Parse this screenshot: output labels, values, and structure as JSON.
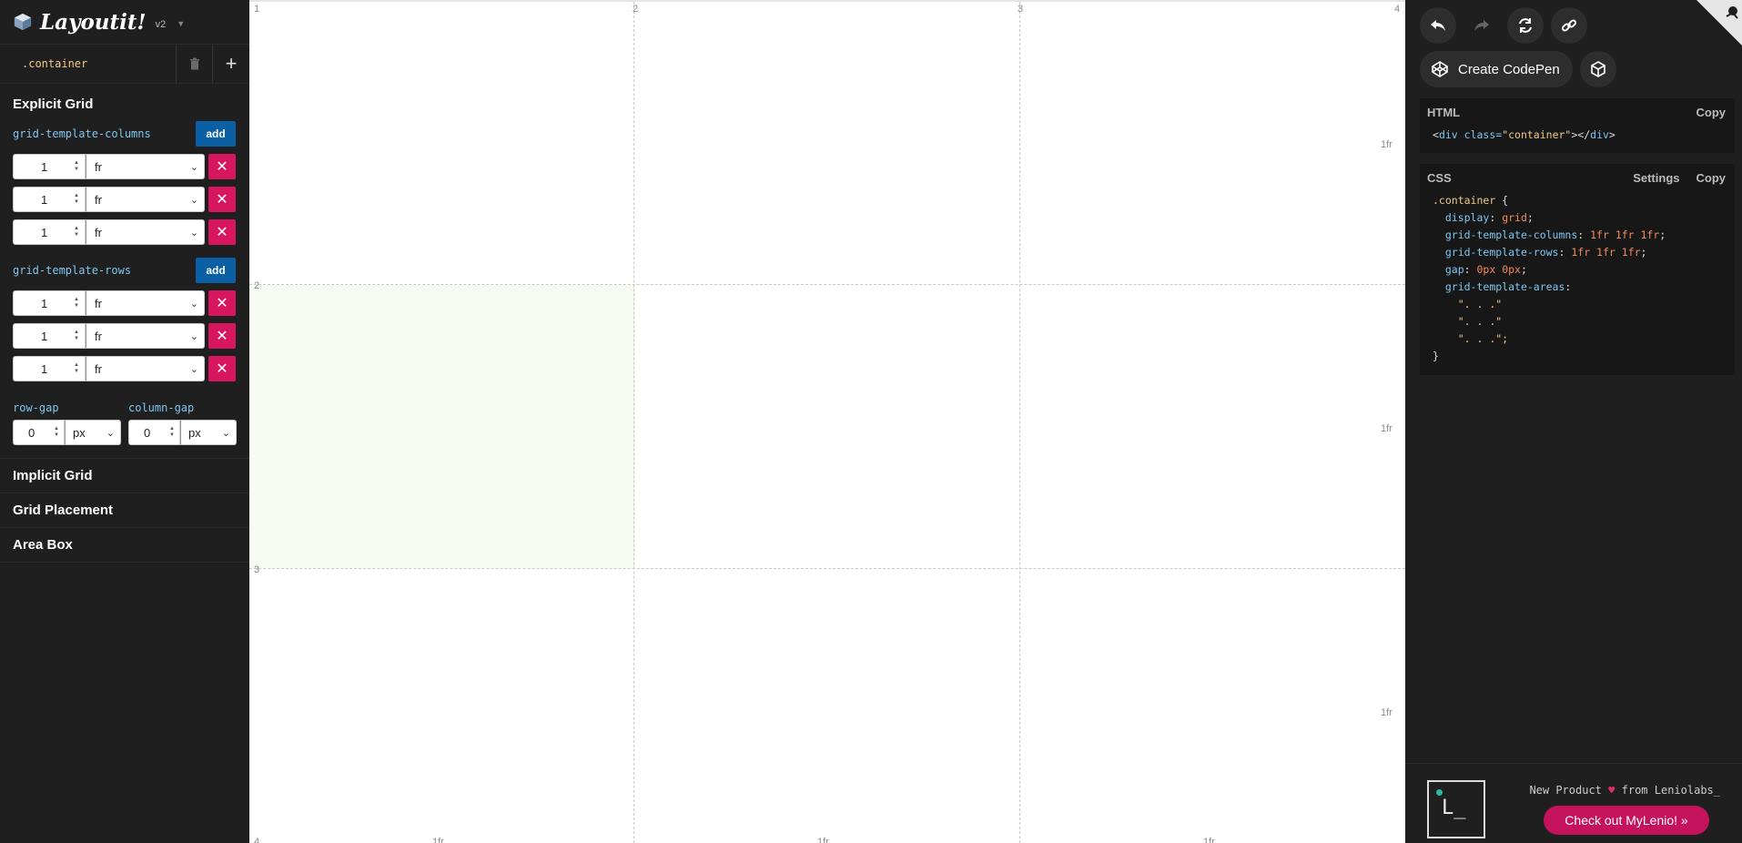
{
  "brand": {
    "name": "Layoutit!",
    "version": "v2"
  },
  "toolbar": {
    "selector": ".container"
  },
  "explicit_grid": {
    "title": "Explicit Grid",
    "columns_label": "grid-template-columns",
    "rows_label": "grid-template-rows",
    "add_label": "add",
    "columns": [
      {
        "value": "1",
        "unit": "fr"
      },
      {
        "value": "1",
        "unit": "fr"
      },
      {
        "value": "1",
        "unit": "fr"
      }
    ],
    "rows": [
      {
        "value": "1",
        "unit": "fr"
      },
      {
        "value": "1",
        "unit": "fr"
      },
      {
        "value": "1",
        "unit": "fr"
      }
    ],
    "row_gap_label": "row-gap",
    "column_gap_label": "column-gap",
    "row_gap": {
      "value": "0",
      "unit": "px"
    },
    "column_gap": {
      "value": "0",
      "unit": "px"
    }
  },
  "sections": [
    "Implicit Grid",
    "Grid Placement",
    "Area Box"
  ],
  "canvas": {
    "col_line_labels": [
      "1",
      "2",
      "3",
      "4"
    ],
    "row_line_labels": [
      "2",
      "3"
    ],
    "row_size_labels": [
      "1fr",
      "1fr",
      "1fr"
    ],
    "bottom_row_line_label": "4",
    "bottom_col_size_labels": [
      "1fr",
      "1fr",
      "1fr"
    ]
  },
  "right_panel": {
    "create_codepen": "Create CodePen",
    "html_title": "HTML",
    "css_title": "CSS",
    "copy_label": "Copy",
    "settings_label": "Settings",
    "html_code": {
      "open": "<",
      "tag": "div",
      "attr": " class=",
      "value": "\"container\"",
      "close_open": "></",
      "tag2": "div",
      "close": ">"
    },
    "css_code": {
      "selector": ".container",
      "open_brace": " {",
      "lines": [
        {
          "prop": "display",
          "val": "grid"
        },
        {
          "prop": "grid-template-columns",
          "val": "1fr 1fr 1fr"
        },
        {
          "prop": "grid-template-rows",
          "val": "1fr 1fr 1fr"
        },
        {
          "prop": "gap",
          "val": "0px 0px"
        }
      ],
      "areas_prop": "grid-template-areas",
      "areas": [
        "\". . .\"",
        "\". . .\"",
        "\". . .\";"
      ],
      "close_brace": "}"
    }
  },
  "promo": {
    "text_before": "New Product",
    "heart": "♥",
    "text_after": "from Leniolabs_",
    "logo_text": "L_",
    "button": "Check out MyLenio! »"
  }
}
